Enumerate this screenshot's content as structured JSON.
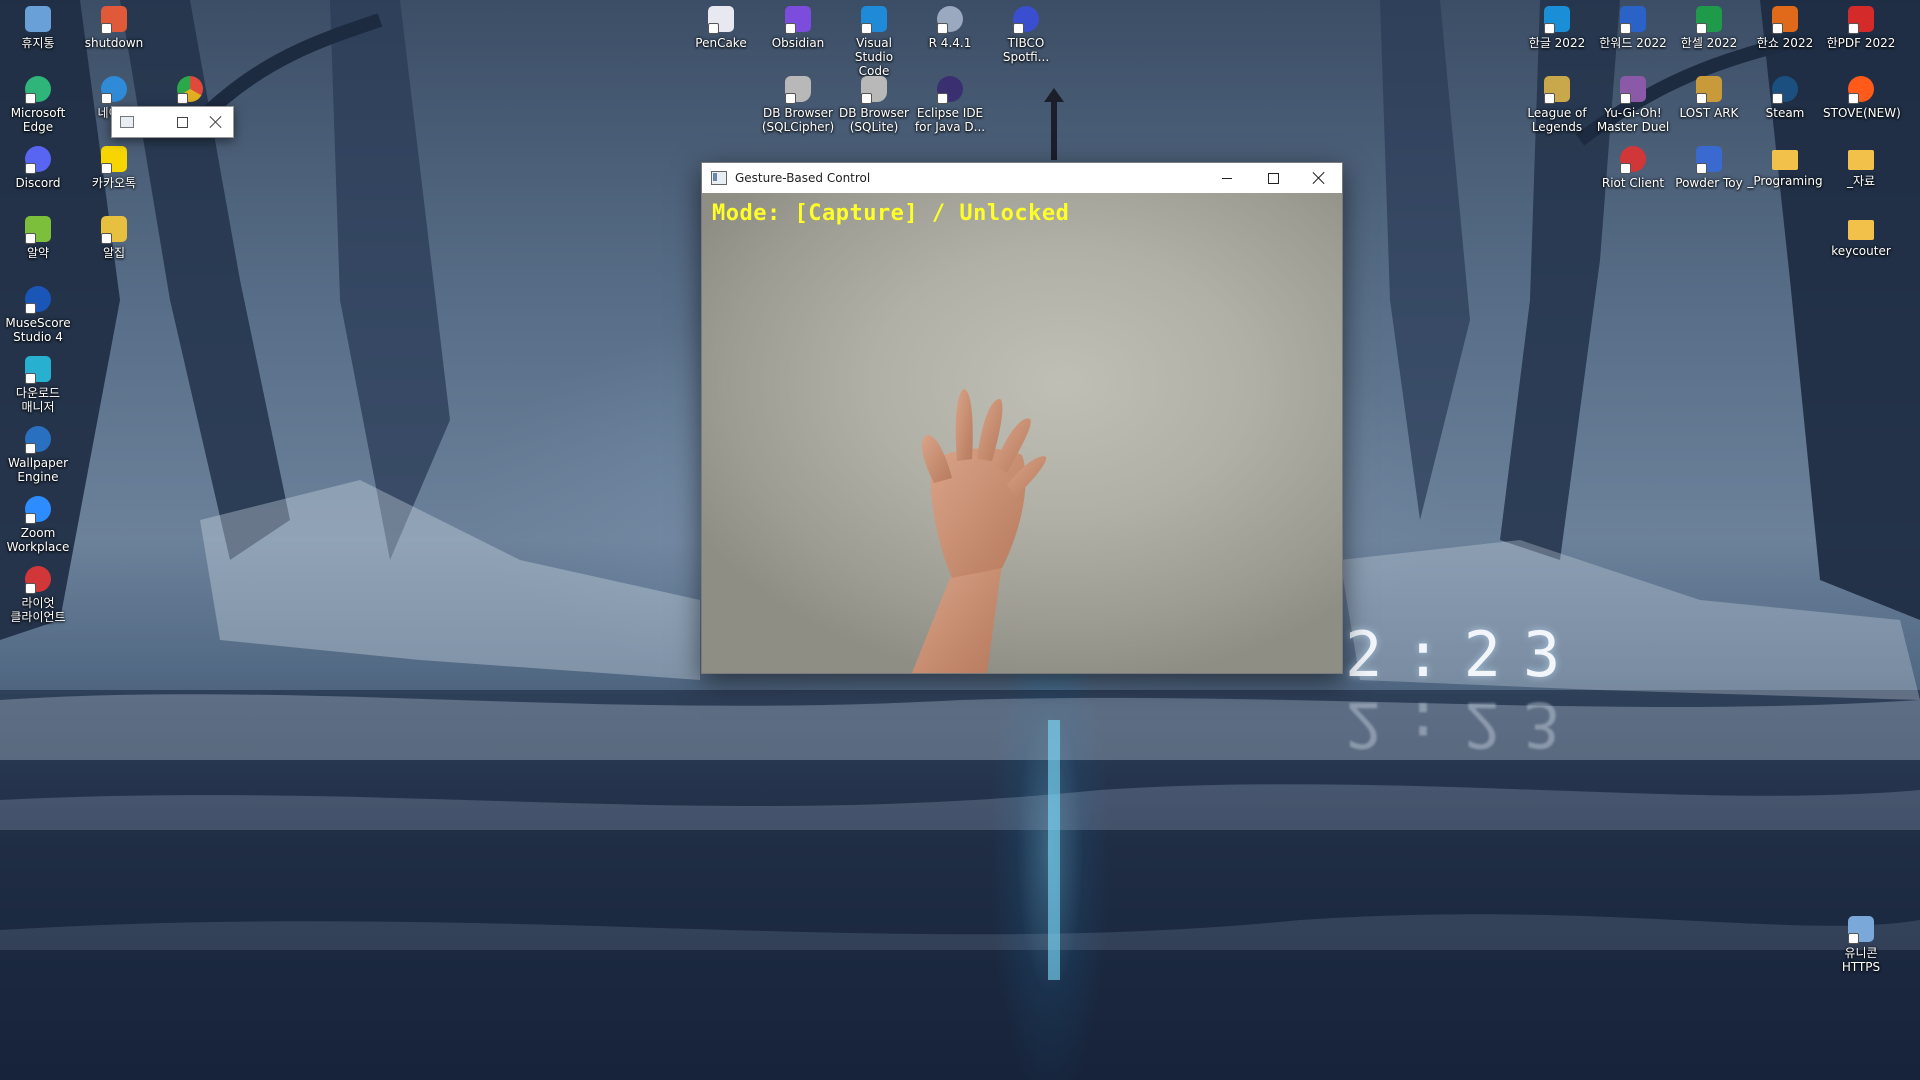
{
  "desktop": {
    "icons": [
      {
        "id": "recycle",
        "label": "휴지통",
        "icon": "recycle-bin-icon",
        "color": "#6aa0d8"
      },
      {
        "id": "shutdown",
        "label": "shutdown",
        "icon": "shutdown-icon",
        "color": "#e05a3a"
      },
      {
        "id": "edge",
        "label": "Microsoft\nEdge",
        "icon": "edge-icon",
        "color": "#2fb47a"
      },
      {
        "id": "naver",
        "label": "네이버",
        "icon": "naver-whale-icon",
        "color": "#2f8ad8"
      },
      {
        "id": "chrome",
        "label": "",
        "icon": "chrome-icon",
        "color": "#e0b020"
      },
      {
        "id": "discord",
        "label": "Discord",
        "icon": "discord-icon",
        "color": "#5865f2"
      },
      {
        "id": "kakaotalk",
        "label": "카카오톡",
        "icon": "kakaotalk-icon",
        "color": "#f7d600"
      },
      {
        "id": "alyac",
        "label": "알약",
        "icon": "alyac-icon",
        "color": "#7bbf3a"
      },
      {
        "id": "alzip",
        "label": "알집",
        "icon": "alzip-icon",
        "color": "#e8c040"
      },
      {
        "id": "musescore",
        "label": "MuseScore\nStudio 4",
        "icon": "musescore-icon",
        "color": "#1a55b8"
      },
      {
        "id": "download",
        "label": "다운로드\n매니저",
        "icon": "download-manager-icon",
        "color": "#28b0d0"
      },
      {
        "id": "wallpaper",
        "label": "Wallpaper\nEngine",
        "icon": "wallpaper-engine-icon",
        "color": "#2a70c0"
      },
      {
        "id": "zoom",
        "label": "Zoom\nWorkplace",
        "icon": "zoom-icon",
        "color": "#2d8cff"
      },
      {
        "id": "riotclient-ko",
        "label": "라이엇\n클라이언트",
        "icon": "riot-client-icon",
        "color": "#d13639"
      },
      {
        "id": "pencake",
        "label": "PenCake",
        "icon": "pencake-icon",
        "color": "#e8e8f0"
      },
      {
        "id": "obsidian",
        "label": "Obsidian",
        "icon": "obsidian-icon",
        "color": "#7c4ddc"
      },
      {
        "id": "vscode",
        "label": "Visual Studio\nCode",
        "icon": "vscode-icon",
        "color": "#1f8ad8"
      },
      {
        "id": "r",
        "label": "R 4.4.1",
        "icon": "r-icon",
        "color": "#9aa8c0"
      },
      {
        "id": "tibco",
        "label": "TIBCO\nSpotfi...",
        "icon": "tibco-spotfire-icon",
        "color": "#3a4fd0"
      },
      {
        "id": "dbcipher",
        "label": "DB Browser\n(SQLCipher)",
        "icon": "db-browser-icon",
        "color": "#b8b8b8"
      },
      {
        "id": "dbsqlite",
        "label": "DB Browser\n(SQLite)",
        "icon": "db-browser-icon",
        "color": "#b8b8b8"
      },
      {
        "id": "eclipse",
        "label": "Eclipse IDE\nfor Java D...",
        "icon": "eclipse-icon",
        "color": "#3a2f70"
      },
      {
        "id": "hangul",
        "label": "한글 2022",
        "icon": "hangul-icon",
        "color": "#1a8fd8"
      },
      {
        "id": "hanword",
        "label": "한워드 2022",
        "icon": "hanword-icon",
        "color": "#2a62c8"
      },
      {
        "id": "hancell",
        "label": "한셀 2022",
        "icon": "hancell-icon",
        "color": "#1f9a4a"
      },
      {
        "id": "hanshow",
        "label": "한쇼 2022",
        "icon": "hanshow-icon",
        "color": "#e06a1a"
      },
      {
        "id": "hanpdf",
        "label": "한PDF 2022",
        "icon": "hanpdf-icon",
        "color": "#d42a2a"
      },
      {
        "id": "lol",
        "label": "League of\nLegends",
        "icon": "league-of-legends-icon",
        "color": "#c8a84a"
      },
      {
        "id": "yugioh",
        "label": "Yu-Gi-Oh!\nMaster Duel",
        "icon": "yugioh-icon",
        "color": "#8a5aa8"
      },
      {
        "id": "lostark",
        "label": "LOST ARK",
        "icon": "lost-ark-icon",
        "color": "#c89a3a"
      },
      {
        "id": "steam",
        "label": "Steam",
        "icon": "steam-icon",
        "color": "#1b4f80"
      },
      {
        "id": "stove",
        "label": "STOVE(NEW)",
        "icon": "stove-icon",
        "color": "#ff5a1a"
      },
      {
        "id": "riot",
        "label": "Riot Client",
        "icon": "riot-client-icon",
        "color": "#d13639"
      },
      {
        "id": "powdertoy",
        "label": "Powder Toy",
        "icon": "powder-toy-icon",
        "color": "#3a6ad0"
      },
      {
        "id": "programing",
        "label": "_Programing",
        "icon": "folder-icon",
        "color": "#f2c14a"
      },
      {
        "id": "jaryo",
        "label": "_자료",
        "icon": "folder-icon",
        "color": "#f2c14a"
      },
      {
        "id": "keycouter",
        "label": "keycouter",
        "icon": "folder-icon",
        "color": "#f2c14a"
      },
      {
        "id": "unicorn",
        "label": "유니콘\nHTTPS",
        "icon": "unicorn-https-icon",
        "color": "#7aa8d8"
      }
    ]
  },
  "gesture_window": {
    "title": "Gesture-Based Control",
    "mode_text": "Mode: [Capture] / Unlocked",
    "minimize_label": "minimize",
    "maximize_label": "maximize",
    "close_label": "close"
  },
  "wallpaper_clock": "2:23"
}
